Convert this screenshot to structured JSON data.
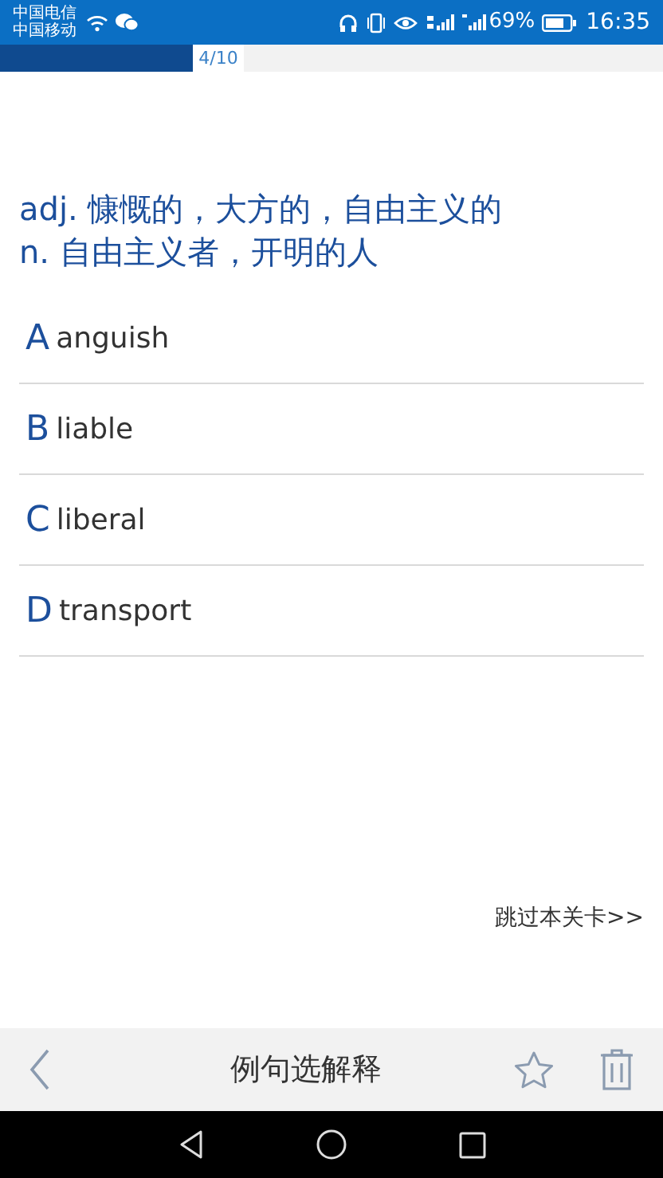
{
  "status_bar": {
    "carriers": [
      "中国电信",
      "中国移动"
    ],
    "battery": "69%",
    "time": "16:35"
  },
  "progress": {
    "level": 0.29,
    "label": "4/10"
  },
  "definition": [
    "adj. 慷慨的，大方的，自由主义的",
    "n. 自由主义者，开明的人"
  ],
  "options": [
    {
      "letter": "A",
      "word": "anguish"
    },
    {
      "letter": "B",
      "word": "liable"
    },
    {
      "letter": "C",
      "word": "liberal"
    },
    {
      "letter": "D",
      "word": "transport"
    }
  ],
  "skip_link": "跳过本关卡>>",
  "bottom_bar": {
    "title": "例句选解释"
  }
}
